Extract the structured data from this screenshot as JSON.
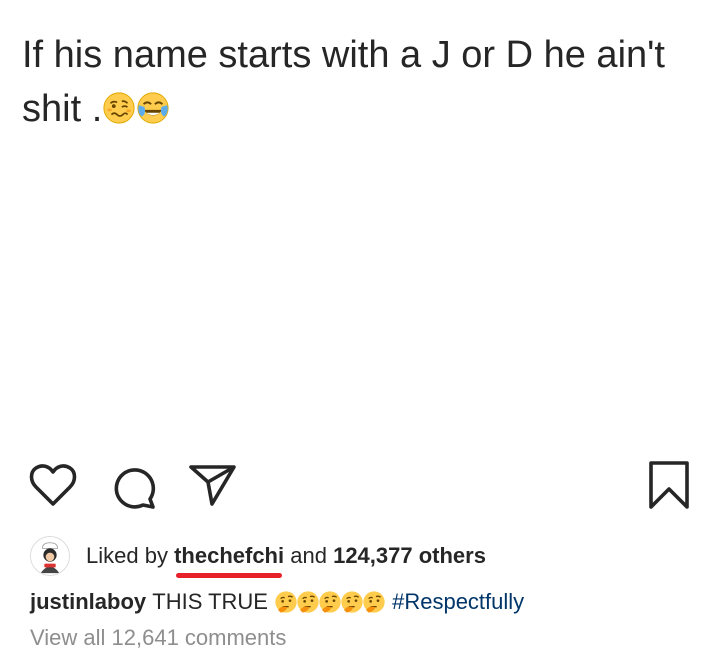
{
  "post": {
    "text": "If his name starts with a J or D he ain't shit .",
    "emojis": [
      "woozy-face",
      "face-with-tears-of-joy"
    ]
  },
  "actions": {
    "like_icon": "heart-icon",
    "comment_icon": "comment-icon",
    "share_icon": "paper-plane-icon",
    "save_icon": "bookmark-icon"
  },
  "likes": {
    "prefix": "Liked by",
    "user": "thechefchi",
    "conjunction": "and",
    "others": "124,377 others"
  },
  "caption": {
    "username": "justinlaboy",
    "text": "THIS TRUE",
    "emojis": [
      "thinking-face",
      "thinking-face",
      "thinking-face",
      "thinking-face",
      "thinking-face"
    ],
    "hashtag": "#Respectfully"
  },
  "comments": {
    "view_all": "View all 12,641 comments"
  },
  "colors": {
    "text": "#262626",
    "hashtag": "#003569",
    "muted": "#8e8e8e",
    "highlight_underline": "#e8202a",
    "emoji_yellow": "#ffcc4d"
  }
}
